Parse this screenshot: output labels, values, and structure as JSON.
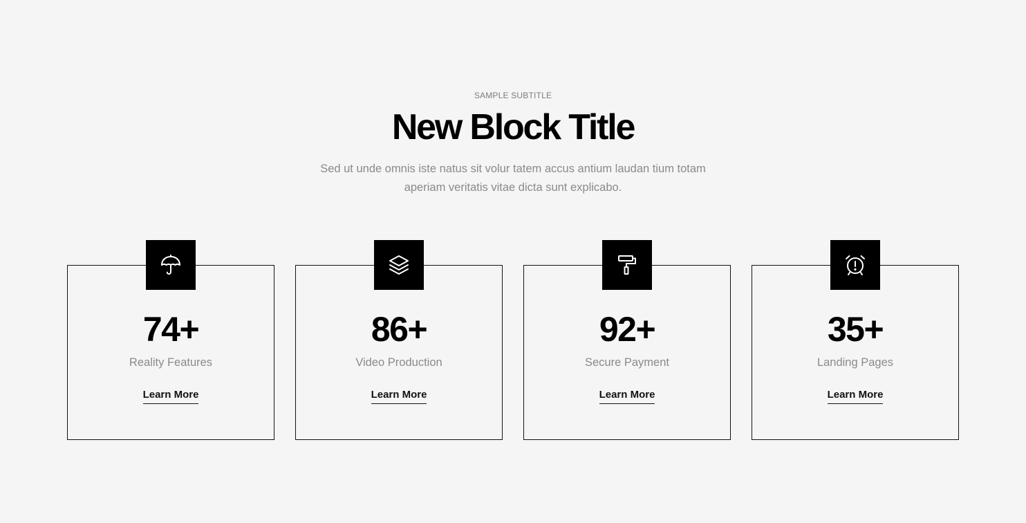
{
  "section": {
    "subtitle": "SAMPLE SUBTITLE",
    "title": "New Block Title",
    "description": "Sed ut unde omnis iste natus sit volur tatem accus antium laudan tium totam aperiam veritatis vitae dicta sunt explicabo."
  },
  "colors": {
    "background": "#f5f5f5",
    "accent": "#000000",
    "muted_text": "#8a8a8a"
  },
  "cards": [
    {
      "icon": "umbrella-icon",
      "number": "74+",
      "label": "Reality Features",
      "link": "Learn More"
    },
    {
      "icon": "layers-icon",
      "number": "86+",
      "label": "Video Production",
      "link": "Learn More"
    },
    {
      "icon": "paint-roller-icon",
      "number": "92+",
      "label": "Secure Payment",
      "link": "Learn More"
    },
    {
      "icon": "alarm-clock-icon",
      "number": "35+",
      "label": "Landing Pages",
      "link": "Learn More"
    }
  ]
}
